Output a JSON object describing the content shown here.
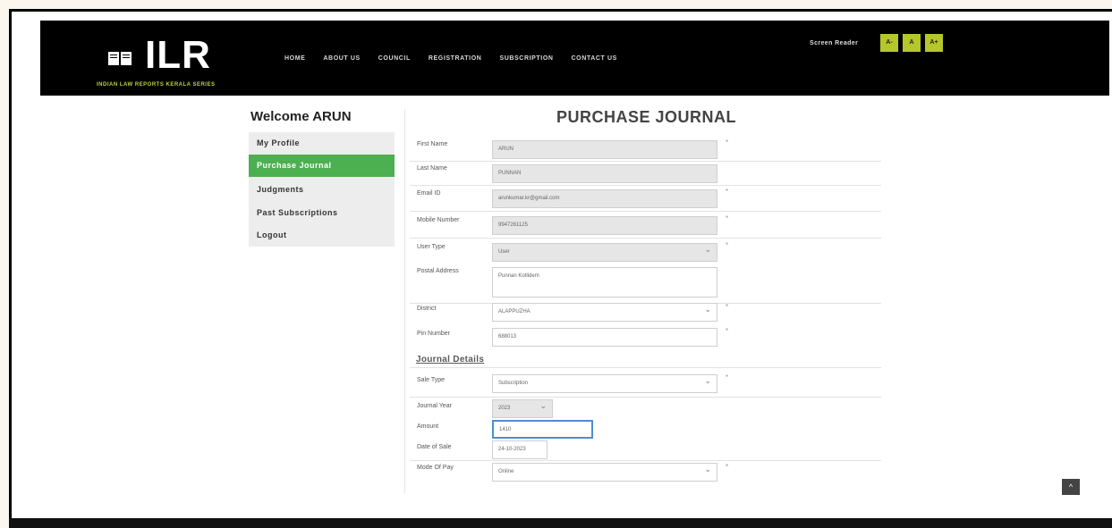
{
  "brand": {
    "logo": "ILR",
    "tagline": "INDIAN LAW REPORTS KERALA SERIES"
  },
  "nav": [
    "HOME",
    "ABOUT US",
    "COUNCIL",
    "REGISTRATION",
    "SUBSCRIPTION",
    "CONTACT US"
  ],
  "screen_reader": {
    "label": "Screen Reader",
    "buttons": [
      "A-",
      "A",
      "A+"
    ]
  },
  "sidebar": {
    "welcome": "Welcome ARUN",
    "items": [
      "My Profile",
      "Purchase Journal",
      "Judgments",
      "Past Subscriptions",
      "Logout"
    ],
    "active": "Purchase Journal"
  },
  "form": {
    "title": "PURCHASE JOURNAL",
    "first_name": {
      "label": "First Name",
      "value": "ARUN"
    },
    "last_name": {
      "label": "Last Name",
      "value": "PUNNAN"
    },
    "email": {
      "label": "Email ID",
      "value": "arunkumar.kr@gmail.com"
    },
    "mobile": {
      "label": "Mobile Number",
      "value": "9947261125"
    },
    "user_type": {
      "label": "User Type",
      "value": "User"
    },
    "postal_address": {
      "label": "Postal Address",
      "value": "Punnan Kotlidem"
    },
    "district": {
      "label": "District",
      "value": "ALAPPUZHA"
    },
    "pin": {
      "label": "Pin Number",
      "value": "688013"
    },
    "journal_heading": "Journal Details",
    "sale_type": {
      "label": "Sale Type",
      "value": "Subscription"
    },
    "journal_year": {
      "label": "Journal Year",
      "value": "2023"
    },
    "amount": {
      "label": "Amount",
      "value": "1410"
    },
    "date_of_sale": {
      "label": "Date of Sale",
      "value": "24-10-2023"
    },
    "mode_of_pay": {
      "label": "Mode Of Pay",
      "value": "Online"
    },
    "required_mark": "*"
  },
  "scroll_top_glyph": "^",
  "colors": {
    "header_bg": "#000000",
    "accent_green": "#4caf50",
    "reader_btn": "#b5c72a"
  }
}
